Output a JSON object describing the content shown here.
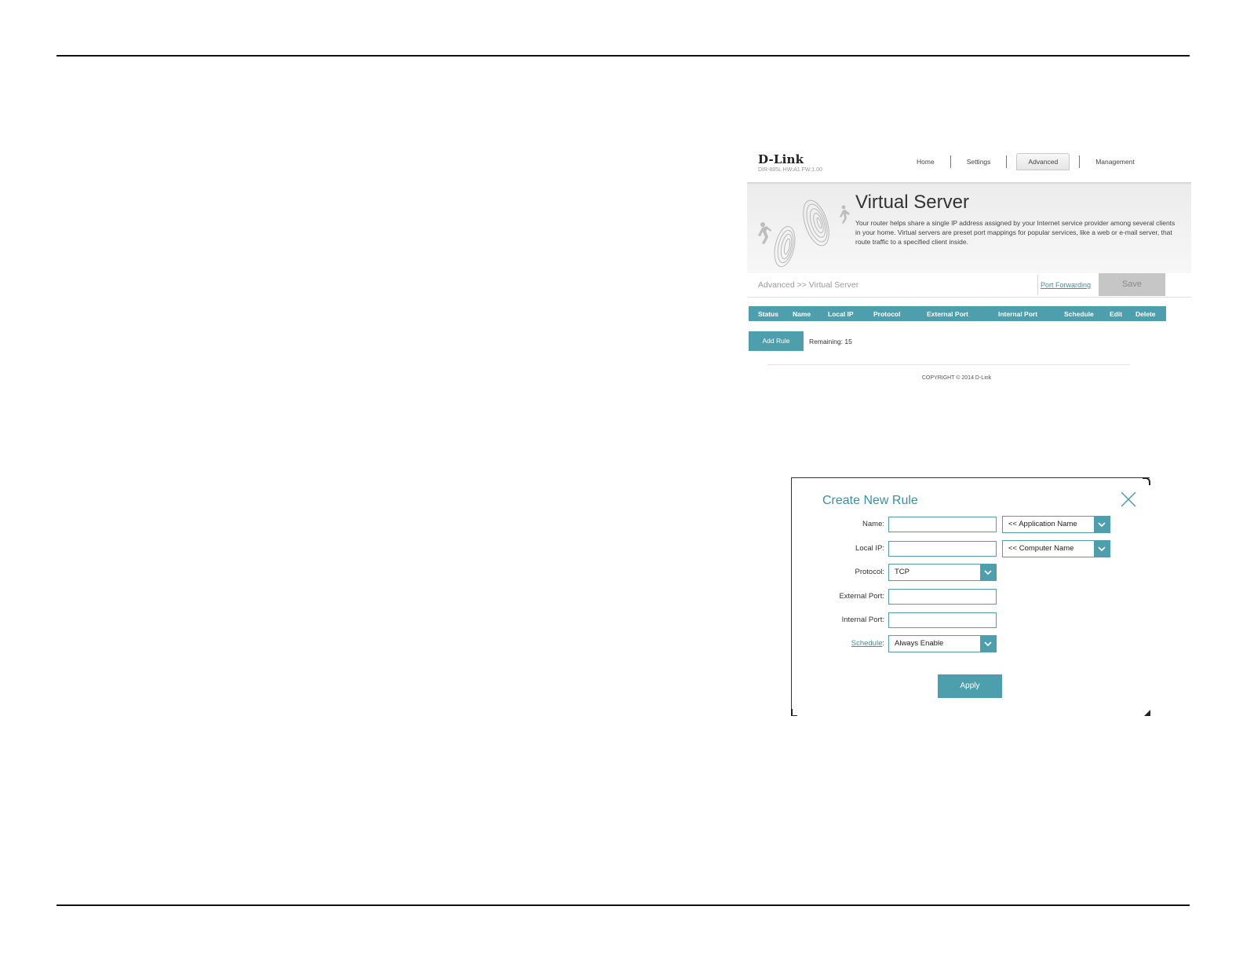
{
  "router": {
    "brand": "D-Link",
    "model_info": "DIR-885L  HW:A1  FW:1.00",
    "nav": {
      "home": "Home",
      "settings": "Settings",
      "advanced": "Advanced",
      "management": "Management",
      "active": "Advanced"
    },
    "page_title": "Virtual Server",
    "description": "Your router helps share a single IP address assigned by your Internet service provider among several clients in your home. Virtual servers are preset port mappings for popular services, like a web or e-mail server, that route traffic to a specified client inside.",
    "breadcrumb": "Advanced >> Virtual Server",
    "port_forwarding_link": "Port Forwarding",
    "save_label": "Save",
    "table_headers": [
      "Status",
      "Name",
      "Local IP",
      "Protocol",
      "External Port",
      "Internal Port",
      "Schedule",
      "Edit",
      "Delete"
    ],
    "add_rule_label": "Add Rule",
    "remaining": "Remaining: 15",
    "copyright": "COPYRIGHT © 2014 D-Link",
    "accent_color": "#4e9fad"
  },
  "dialog": {
    "title": "Create New Rule",
    "fields": {
      "name_label": "Name:",
      "name_value": "",
      "application_select": "<< Application Name",
      "local_ip_label": "Local IP:",
      "local_ip_value": "",
      "computer_select": "<< Computer Name",
      "protocol_label": "Protocol:",
      "protocol_value": "TCP",
      "external_port_label": "External Port:",
      "external_port_value": "",
      "internal_port_label": "Internal Port:",
      "internal_port_value": "",
      "schedule_label": "Schedule",
      "schedule_value": "Always Enable"
    },
    "apply_label": "Apply",
    "close_icon": "close-icon"
  }
}
